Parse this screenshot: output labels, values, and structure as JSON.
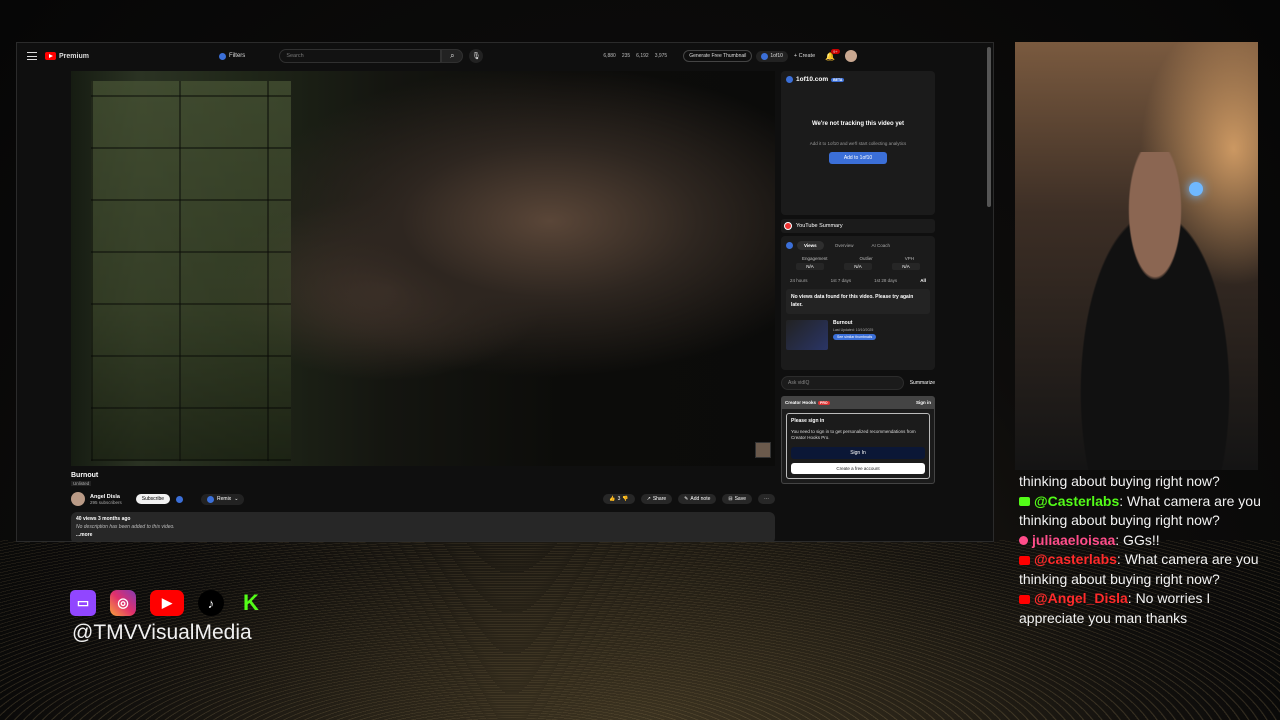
{
  "youtube": {
    "logo_label": "Premium",
    "filters_label": "Filters",
    "search_placeholder": "Search",
    "stats": [
      "6,880",
      "235",
      "6,192",
      "3,975"
    ],
    "generate_thumbnail": "Generate Free Thumbnail",
    "tenten_chip": "1of10",
    "create_label": "+ Create",
    "notif_badge": "9+"
  },
  "video": {
    "title": "Burnout",
    "visibility": "Unlisted",
    "channel_name": "Angel Disla",
    "channel_subs": "295 subscribers",
    "subscribe_label": "Subscribe",
    "remix_label": "Remix",
    "like_count": "3",
    "share_label": "Share",
    "add_note_label": "Add note",
    "save_label": "Save",
    "desc_views": "40 views  3 months ago",
    "desc_text": "No description has been added to this video.",
    "desc_more": "...more"
  },
  "tenten": {
    "brand": "1of10.com",
    "beta": "BETA",
    "heading": "We're not tracking this video yet",
    "subtext": "Add it to 1of10 and we'll start collecting analytics",
    "button": "Add to 1of10"
  },
  "yt_summary": {
    "title": "YouTube Summary",
    "tabs": [
      "Views",
      "Overview",
      "AI Coach"
    ],
    "metric_labels": [
      "Engagement",
      "Outlier",
      "VPH"
    ],
    "metric_values": [
      "N/A",
      "N/A",
      "N/A"
    ],
    "periods": [
      "24 hours",
      "1st 7 days",
      "1st 28 days",
      "All"
    ],
    "no_data": "No views data found for this video. Please try again later.",
    "mini_title": "Burnout",
    "mini_date": "Last Updated: 10/10/2025",
    "mini_button": "See similar thumbnails"
  },
  "ask": {
    "placeholder": "Ask vidIQ",
    "summarize": "Summarize"
  },
  "creator_hooks": {
    "title": "Creator Hooks",
    "pro": "PRO",
    "signin_link": "Sign in",
    "please_sign_in": "Please sign in",
    "text": "You need to sign in to get personalized recommendations from Creator Hooks Pro.",
    "signin_button": "Sign In",
    "create_account": "Create a free account"
  },
  "chat": {
    "lead_text": "thinking about buying right now?",
    "messages": [
      {
        "platform": "kick",
        "user": "@Casterlabs",
        "text": ": What camera are you thinking about buying right now?"
      },
      {
        "platform": "tiktok",
        "user": "juliaaeloisaa",
        "text": ": GGs!!"
      },
      {
        "platform": "youtube",
        "user": "@casterlabs",
        "text": ": What camera are you thinking about buying right now?"
      },
      {
        "platform": "youtube",
        "user": "@Angel_Disla",
        "text": ": No worries I appreciate you man thanks"
      }
    ]
  },
  "socials": {
    "handle": "@TMVVisualMedia",
    "icons": [
      "twitch-icon",
      "instagram-icon",
      "youtube-icon",
      "tiktok-icon",
      "kick-icon"
    ]
  },
  "colors": {
    "youtube_red": "#ff0000",
    "kick_green": "#53fc18",
    "twitch_purple": "#9146ff",
    "accent_blue": "#3b6fd8"
  }
}
